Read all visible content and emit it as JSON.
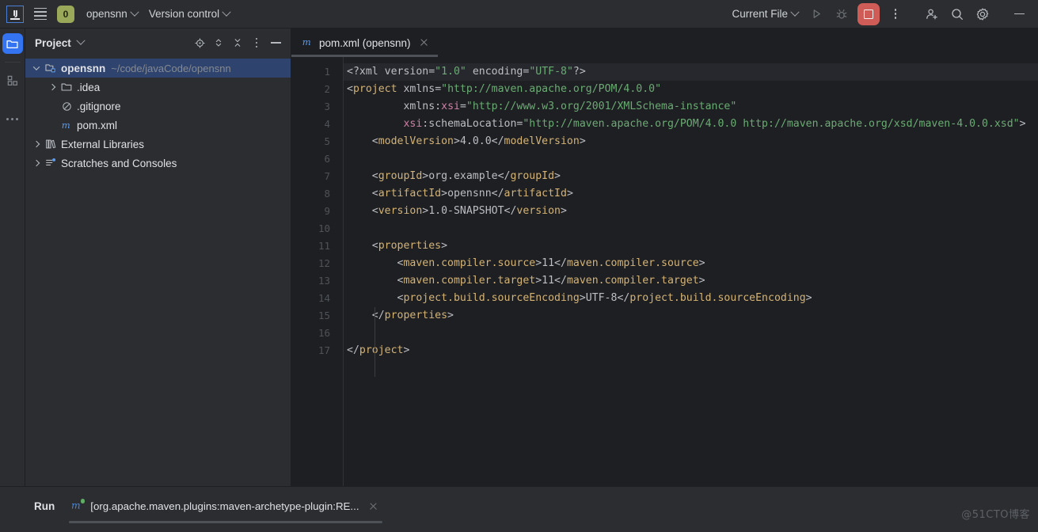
{
  "titlebar": {
    "logo": "ij-logo",
    "menu_icon": "hamburger-menu-icon",
    "project_badge": "0",
    "project_name": "opensnn",
    "version_control": "Version control",
    "run_config": "Current File",
    "icons": {
      "run": "run-icon",
      "debug": "debug-icon",
      "stop": "stop-icon",
      "more": "more-options-icon",
      "add_user": "add-user-icon",
      "search": "search-icon",
      "settings": "settings-gear-icon",
      "minimize": "minimize-icon"
    }
  },
  "rail": {
    "items": [
      {
        "name": "project-tool-window",
        "icon": "folder-icon",
        "active": true
      },
      {
        "name": "structure-tool-window",
        "icon": "structure-icon",
        "active": false
      },
      {
        "name": "more-tool-windows",
        "icon": "more-dots-icon",
        "active": false
      }
    ]
  },
  "project_panel": {
    "title": "Project",
    "tools": [
      {
        "name": "select-opened-file",
        "icon": "target-icon"
      },
      {
        "name": "expand-collapse",
        "icon": "chevron-up-down-icon"
      },
      {
        "name": "collapse-all",
        "icon": "collapse-arrows-icon"
      },
      {
        "name": "options-menu",
        "icon": "kebab-icon"
      },
      {
        "name": "hide-panel",
        "icon": "minimize-icon"
      }
    ],
    "tree": [
      {
        "label": "opensnn",
        "path": "~/code/javaCode/opensnn",
        "icon": "project-module-icon",
        "depth": 0,
        "arrow": "open",
        "selected": true,
        "bold": true
      },
      {
        "label": ".idea",
        "path": "",
        "icon": "folder-icon",
        "depth": 1,
        "arrow": "closed",
        "selected": false,
        "bold": false
      },
      {
        "label": ".gitignore",
        "path": "",
        "icon": "gitignore-icon",
        "depth": 1,
        "arrow": "none",
        "selected": false,
        "bold": false
      },
      {
        "label": "pom.xml",
        "path": "",
        "icon": "maven-icon",
        "depth": 1,
        "arrow": "none",
        "selected": false,
        "bold": false
      },
      {
        "label": "External Libraries",
        "path": "",
        "icon": "libraries-icon",
        "depth": 0,
        "arrow": "closed",
        "selected": false,
        "bold": false
      },
      {
        "label": "Scratches and Consoles",
        "path": "",
        "icon": "scratches-icon",
        "depth": 0,
        "arrow": "closed",
        "selected": false,
        "bold": false
      }
    ]
  },
  "editor": {
    "tabs": [
      {
        "label": "pom.xml (opensnn)",
        "icon": "maven-icon",
        "active": true,
        "close": "close-tab-icon"
      }
    ],
    "line_numbers": [
      1,
      2,
      3,
      4,
      5,
      6,
      7,
      8,
      9,
      10,
      11,
      12,
      13,
      14,
      15,
      16,
      17
    ],
    "lines": [
      [
        {
          "t": "<?xml ",
          "c": "br"
        },
        {
          "t": "version",
          "c": "at"
        },
        {
          "t": "=",
          "c": "br"
        },
        {
          "t": "\"1.0\"",
          "c": "st"
        },
        {
          "t": " ",
          "c": "br"
        },
        {
          "t": "encoding",
          "c": "at"
        },
        {
          "t": "=",
          "c": "br"
        },
        {
          "t": "\"UTF-8\"",
          "c": "st"
        },
        {
          "t": "?>",
          "c": "br"
        }
      ],
      [
        {
          "t": "<",
          "c": "br"
        },
        {
          "t": "project",
          "c": "tg"
        },
        {
          "t": " ",
          "c": "br"
        },
        {
          "t": "xmlns",
          "c": "at"
        },
        {
          "t": "=",
          "c": "br"
        },
        {
          "t": "\"http://maven.apache.org/POM/4.0.0\"",
          "c": "st"
        }
      ],
      [
        {
          "t": "         ",
          "c": "br"
        },
        {
          "t": "xmlns",
          "c": "at"
        },
        {
          "t": ":",
          "c": "br"
        },
        {
          "t": "xsi",
          "c": "ns"
        },
        {
          "t": "=",
          "c": "br"
        },
        {
          "t": "\"http://www.w3.org/2001/XMLSchema-instance\"",
          "c": "st"
        }
      ],
      [
        {
          "t": "         ",
          "c": "br"
        },
        {
          "t": "xsi",
          "c": "ns"
        },
        {
          "t": ":",
          "c": "br"
        },
        {
          "t": "schemaLocation",
          "c": "at"
        },
        {
          "t": "=",
          "c": "br"
        },
        {
          "t": "\"http://maven.apache.org/POM/4.0.0 http://maven.apache.org/xsd/maven-4.0.0.xsd\"",
          "c": "st"
        },
        {
          "t": ">",
          "c": "br"
        }
      ],
      [
        {
          "t": "    <",
          "c": "br"
        },
        {
          "t": "modelVersion",
          "c": "tg"
        },
        {
          "t": ">",
          "c": "br"
        },
        {
          "t": "4.0.0",
          "c": "tx"
        },
        {
          "t": "</",
          "c": "br"
        },
        {
          "t": "modelVersion",
          "c": "tg"
        },
        {
          "t": ">",
          "c": "br"
        }
      ],
      [],
      [
        {
          "t": "    <",
          "c": "br"
        },
        {
          "t": "groupId",
          "c": "tg"
        },
        {
          "t": ">",
          "c": "br"
        },
        {
          "t": "org.example",
          "c": "tx"
        },
        {
          "t": "</",
          "c": "br"
        },
        {
          "t": "groupId",
          "c": "tg"
        },
        {
          "t": ">",
          "c": "br"
        }
      ],
      [
        {
          "t": "    <",
          "c": "br"
        },
        {
          "t": "artifactId",
          "c": "tg"
        },
        {
          "t": ">",
          "c": "br"
        },
        {
          "t": "opensnn",
          "c": "tx"
        },
        {
          "t": "</",
          "c": "br"
        },
        {
          "t": "artifactId",
          "c": "tg"
        },
        {
          "t": ">",
          "c": "br"
        }
      ],
      [
        {
          "t": "    <",
          "c": "br"
        },
        {
          "t": "version",
          "c": "tg"
        },
        {
          "t": ">",
          "c": "br"
        },
        {
          "t": "1.0-SNAPSHOT",
          "c": "tx"
        },
        {
          "t": "</",
          "c": "br"
        },
        {
          "t": "version",
          "c": "tg"
        },
        {
          "t": ">",
          "c": "br"
        }
      ],
      [],
      [
        {
          "t": "    <",
          "c": "br"
        },
        {
          "t": "properties",
          "c": "tg"
        },
        {
          "t": ">",
          "c": "br"
        }
      ],
      [
        {
          "t": "        <",
          "c": "br"
        },
        {
          "t": "maven.compiler.source",
          "c": "tg"
        },
        {
          "t": ">",
          "c": "br"
        },
        {
          "t": "11",
          "c": "tx"
        },
        {
          "t": "</",
          "c": "br"
        },
        {
          "t": "maven.compiler.source",
          "c": "tg"
        },
        {
          "t": ">",
          "c": "br"
        }
      ],
      [
        {
          "t": "        <",
          "c": "br"
        },
        {
          "t": "maven.compiler.target",
          "c": "tg"
        },
        {
          "t": ">",
          "c": "br"
        },
        {
          "t": "11",
          "c": "tx"
        },
        {
          "t": "</",
          "c": "br"
        },
        {
          "t": "maven.compiler.target",
          "c": "tg"
        },
        {
          "t": ">",
          "c": "br"
        }
      ],
      [
        {
          "t": "        <",
          "c": "br"
        },
        {
          "t": "project.build.sourceEncoding",
          "c": "tg"
        },
        {
          "t": ">",
          "c": "br"
        },
        {
          "t": "UTF-8",
          "c": "tx"
        },
        {
          "t": "</",
          "c": "br"
        },
        {
          "t": "project.build.sourceEncoding",
          "c": "tg"
        },
        {
          "t": ">",
          "c": "br"
        }
      ],
      [
        {
          "t": "    </",
          "c": "br"
        },
        {
          "t": "properties",
          "c": "tg"
        },
        {
          "t": ">",
          "c": "br"
        }
      ],
      [],
      [
        {
          "t": "</",
          "c": "br"
        },
        {
          "t": "project",
          "c": "tg"
        },
        {
          "t": ">",
          "c": "br"
        }
      ]
    ],
    "highlighted_line": 1
  },
  "run_panel": {
    "label": "Run",
    "tab": {
      "icon": "maven-run-icon",
      "label": "[org.apache.maven.plugins:maven-archetype-plugin:RE...",
      "close": "close-tab-icon"
    }
  },
  "watermark": "@51CTO博客",
  "colors": {
    "accent_blue": "#3574f0",
    "selection_blue": "#2e436e",
    "badge_green": "#9aa85a",
    "stop_red": "#d05c57",
    "editor_bg": "#1e1f22",
    "panel_bg": "#2b2d30",
    "tag": "#d4b375",
    "string": "#6aab73",
    "namespace": "#cf7fa7"
  }
}
